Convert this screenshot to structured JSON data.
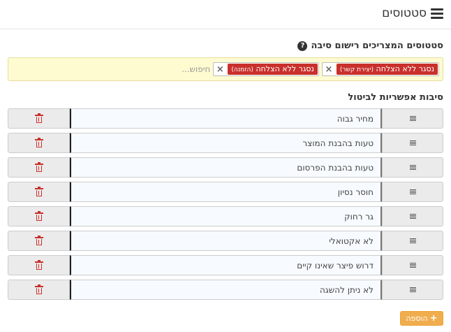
{
  "header": {
    "title": "סטטוסים",
    "icon": "list-icon"
  },
  "reason_statuses": {
    "label": "סטטוסים המצריכים רישום סיבה",
    "help_icon": "question-circle-icon",
    "tags": [
      {
        "label": "נסגר ללא הצלחה",
        "sub": "(יצירת קשר)",
        "remove": "×"
      },
      {
        "label": "נסגר ללא הצלחה",
        "sub": "(הזמנה)",
        "remove": "×"
      }
    ],
    "search_placeholder": "חיפוש..."
  },
  "cancel_reasons": {
    "label": "סיבות אפשריות לביטול",
    "items": [
      "מחיר גבוה",
      "טעות בהבנת המוצר",
      "טעות בהבנת הפרסום",
      "חוסר נסיון",
      "גר רחוק",
      "לא אקטואלי",
      "דרוש פיצר שאינו קיים",
      "לא ניתן להשגה"
    ],
    "drag_icon": "drag-handle-icon",
    "delete_icon": "trash-icon"
  },
  "add_button": {
    "label": "הוספה",
    "icon": "plus-icon"
  },
  "colors": {
    "tag": "#c9302c",
    "tagbox_bg": "#fffbd1",
    "add_button": "#f0ad4e"
  }
}
